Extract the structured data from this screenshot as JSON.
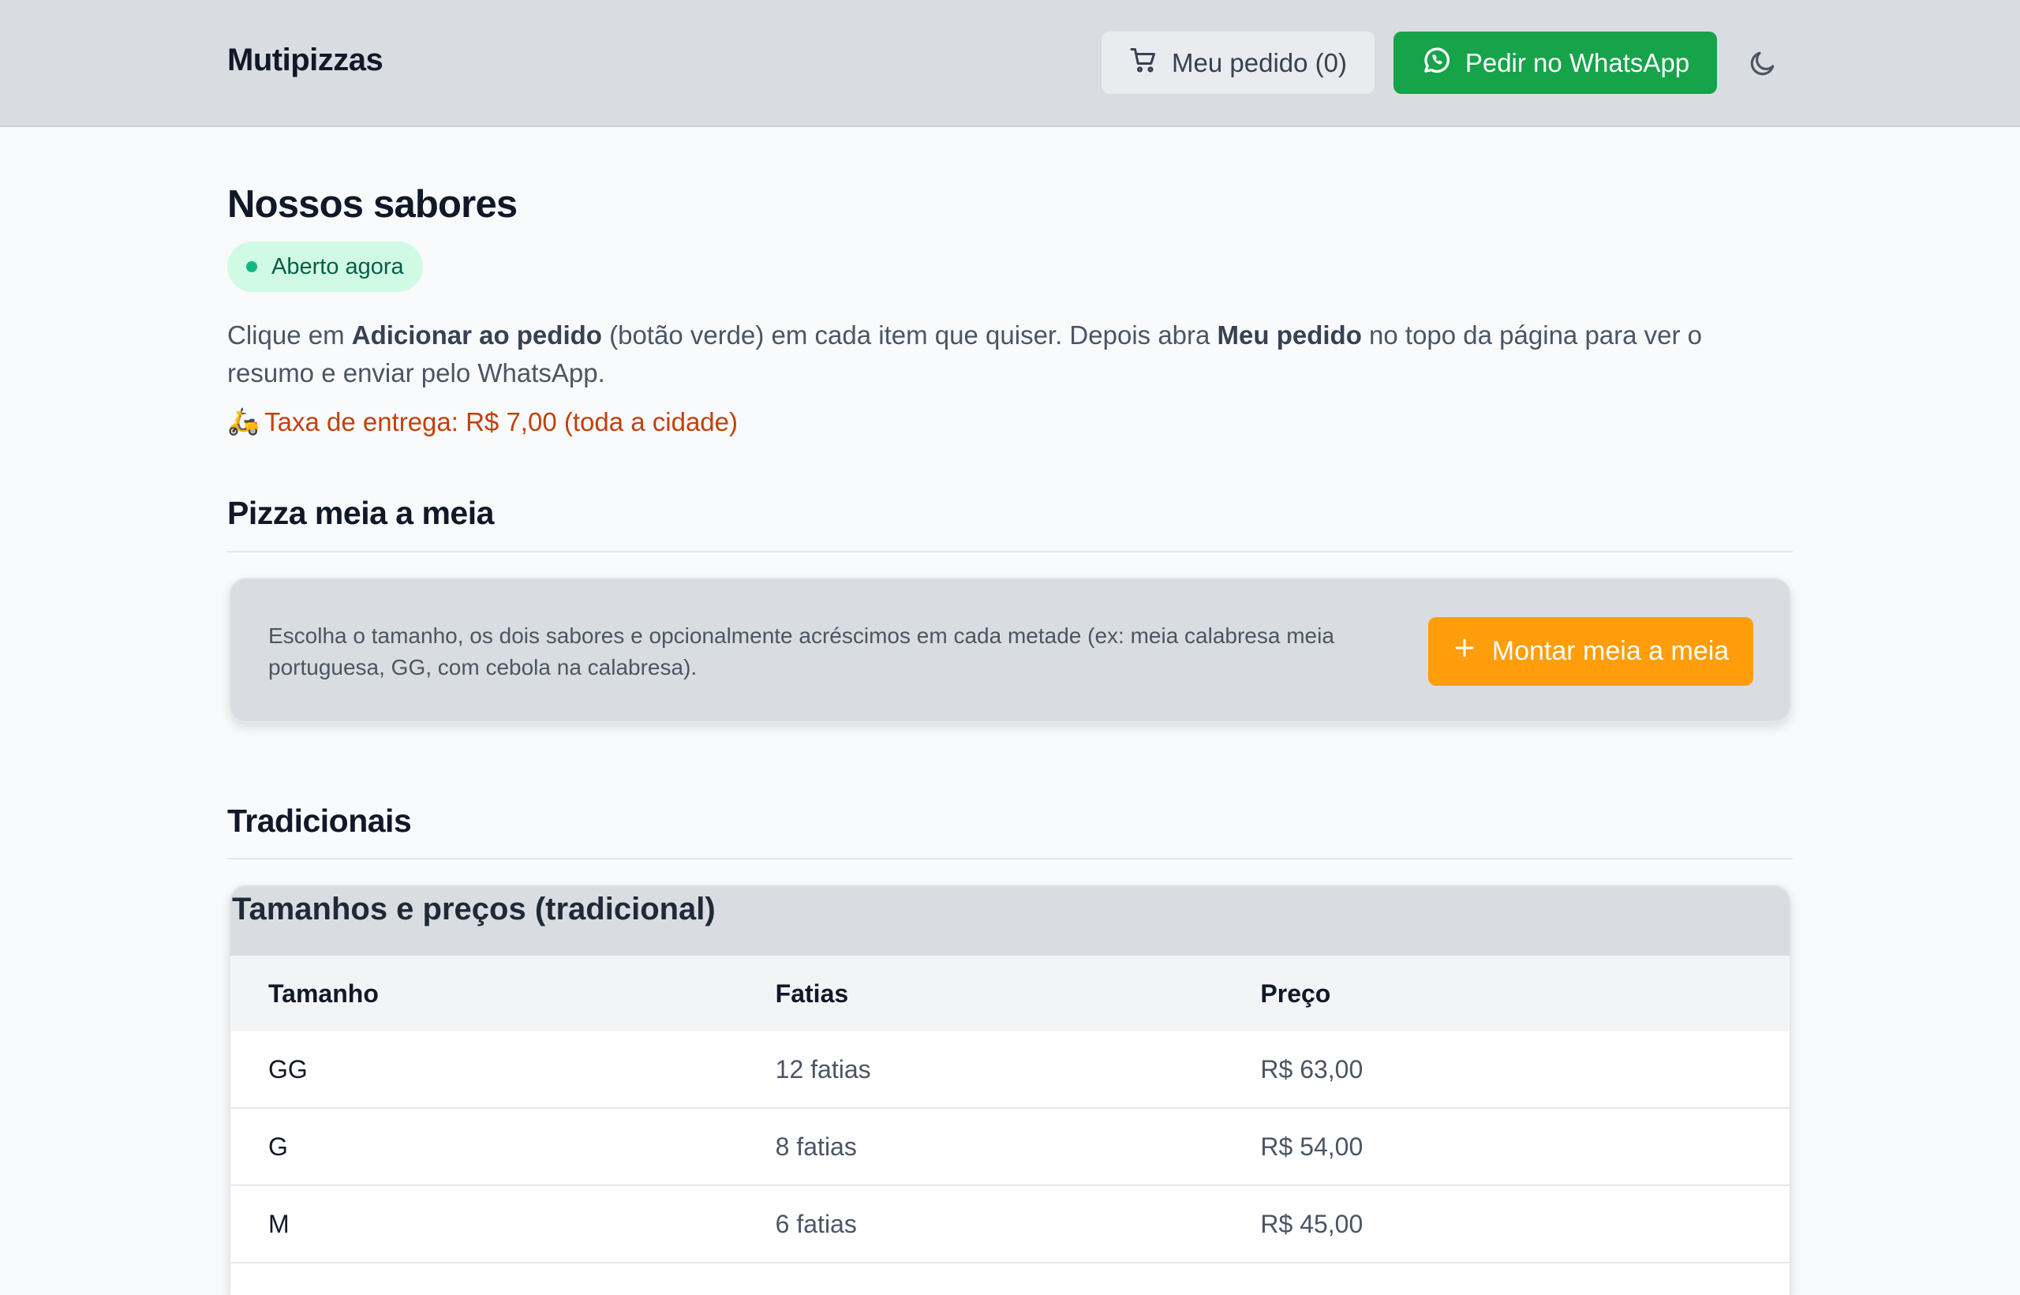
{
  "header": {
    "brand": "Mutipizzas",
    "order_button": "Meu pedido (0)",
    "whatsapp_button": "Pedir no WhatsApp"
  },
  "intro": {
    "title": "Nossos sabores",
    "status": "Aberto agora",
    "text_1": "Clique em ",
    "bold_1": "Adicionar ao pedido",
    "text_2": " (botão verde) em cada item que quiser. Depois abra ",
    "bold_2": "Meu pedido",
    "text_3": " no topo da página para ver o resumo e enviar pelo WhatsApp.",
    "delivery_emoji": "🛵",
    "delivery_fee": "Taxa de entrega: R$ 7,00 (toda a cidade)"
  },
  "half_half": {
    "title": "Pizza meia a meia",
    "description": "Escolha o tamanho, os dois sabores e opcionalmente acréscimos em cada metade (ex: meia calabresa meia portuguesa, GG, com cebola na calabresa).",
    "button": "Montar meia a meia"
  },
  "traditional": {
    "title": "Tradicionais",
    "table_caption": "Tamanhos e preços (tradicional)",
    "columns": [
      "Tamanho",
      "Fatias",
      "Preço"
    ],
    "rows": [
      [
        "GG",
        "12 fatias",
        "R$ 63,00"
      ],
      [
        "G",
        "8 fatias",
        "R$ 54,00"
      ],
      [
        "M",
        "6 fatias",
        "R$ 45,00"
      ]
    ]
  },
  "colors": {
    "whatsapp_green": "#16a34a",
    "half_button_orange": "#ff9d0a",
    "delivery_text": "#c2410c",
    "status_bg": "#d1fae5"
  }
}
